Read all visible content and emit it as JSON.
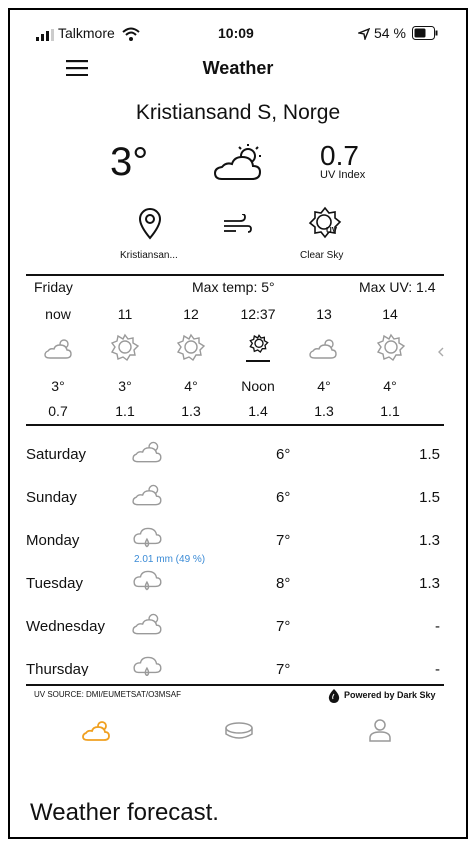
{
  "status_bar": {
    "carrier": "Talkmore",
    "time": "10:09",
    "battery": "54 %"
  },
  "header": {
    "title": "Weather",
    "menu_icon": "hamburger-icon"
  },
  "current": {
    "location": "Kristiansand S, Norge",
    "temperature": "3°",
    "condition_icon": "partly-cloudy-icon",
    "uv_value": "0.7",
    "uv_label": "UV Index"
  },
  "quick_info": {
    "location_short": "Kristiansan...",
    "wind_icon": "wind-icon",
    "sky_label": "Clear Sky"
  },
  "today": {
    "day": "Friday",
    "max_temp": "Max temp: 5°",
    "max_uv": "Max UV: 1.4",
    "hours": [
      {
        "label": "now",
        "icon": "partly-cloudy-icon",
        "temp": "3°",
        "uv": "0.7"
      },
      {
        "label": "11",
        "icon": "sun-icon",
        "temp": "3°",
        "uv": "1.1"
      },
      {
        "label": "12",
        "icon": "sun-icon",
        "temp": "4°",
        "uv": "1.3"
      },
      {
        "label": "12:37",
        "icon": "sun-icon",
        "temp": "Noon",
        "uv": "1.4"
      },
      {
        "label": "13",
        "icon": "partly-cloudy-icon",
        "temp": "4°",
        "uv": "1.3"
      },
      {
        "label": "14",
        "icon": "sun-icon",
        "temp": "4°",
        "uv": "1.1"
      }
    ]
  },
  "forecast": [
    {
      "day": "Saturday",
      "icon": "partly-cloudy-icon",
      "temp": "6°",
      "uv": "1.5",
      "rain": ""
    },
    {
      "day": "Sunday",
      "icon": "partly-cloudy-icon",
      "temp": "6°",
      "uv": "1.5",
      "rain": ""
    },
    {
      "day": "Monday",
      "icon": "rain-cloud-icon",
      "temp": "7°",
      "uv": "1.3",
      "rain": "2.01 mm (49 %)"
    },
    {
      "day": "Tuesday",
      "icon": "rain-cloud-icon",
      "temp": "8°",
      "uv": "1.3",
      "rain": ""
    },
    {
      "day": "Wednesday",
      "icon": "partly-cloudy-icon",
      "temp": "7°",
      "uv": "-",
      "rain": ""
    },
    {
      "day": "Thursday",
      "icon": "rain-cloud-icon",
      "temp": "7°",
      "uv": "-",
      "rain": ""
    }
  ],
  "footer": {
    "uv_source": "UV SOURCE: DMI/EUMETSAT/O3MSAF",
    "powered_by": "Powered by Dark Sky"
  },
  "tabs": [
    {
      "name": "weather",
      "icon": "weather-tab-icon"
    },
    {
      "name": "sunscreen",
      "icon": "sunscreen-tab-icon"
    },
    {
      "name": "profile",
      "icon": "profile-tab-icon"
    }
  ],
  "caption": "Weather forecast.",
  "colors": {
    "accent": "#f0a020",
    "rain": "#3b8bd6",
    "icon_gray": "#9a9a9a"
  }
}
